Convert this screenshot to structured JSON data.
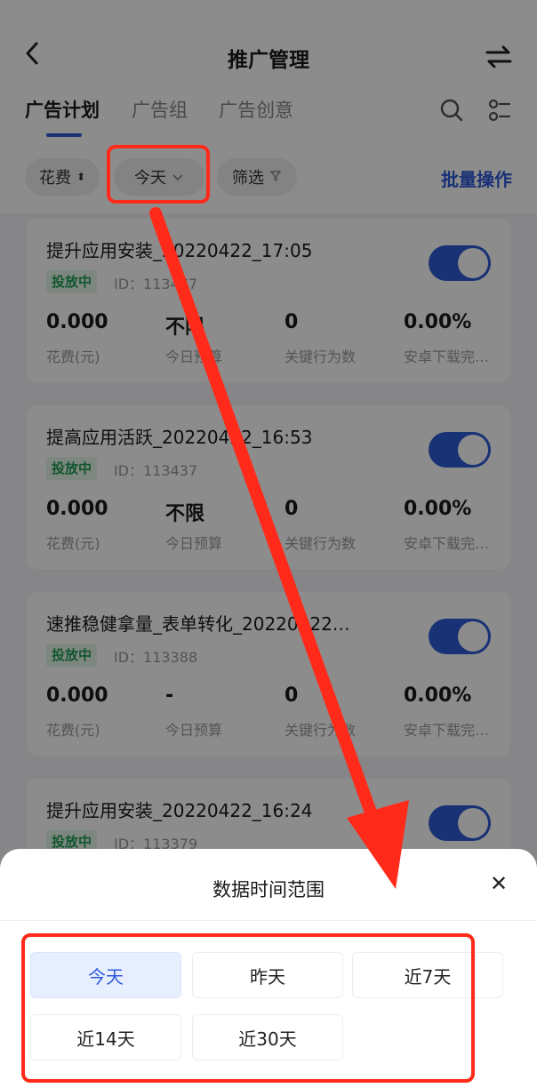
{
  "header": {
    "title": "推广管理"
  },
  "tabs": [
    {
      "label": "广告计划"
    },
    {
      "label": "广告组"
    },
    {
      "label": "广告创意"
    }
  ],
  "filters": {
    "sort_label": "花费",
    "date_label": "今天",
    "filter_label": "筛选",
    "batch_label": "批量操作"
  },
  "campaigns": [
    {
      "name": "提升应用安装_20220422_17:05",
      "status": "投放中",
      "id": "ID：113477",
      "spend": "0.000",
      "spend_label": "花费(元)",
      "budget": "不限",
      "budget_label": "今日预算",
      "actions": "0",
      "actions_label": "关键行为数",
      "rate": "0.00%",
      "rate_label": "安卓下载完…"
    },
    {
      "name": "提高应用活跃_20220422_16:53",
      "status": "投放中",
      "id": "ID：113437",
      "spend": "0.000",
      "spend_label": "花费(元)",
      "budget": "不限",
      "budget_label": "今日预算",
      "actions": "0",
      "actions_label": "关键行为数",
      "rate": "0.00%",
      "rate_label": "安卓下载完…"
    },
    {
      "name": "速推稳健拿量_表单转化_20220422…",
      "status": "投放中",
      "id": "ID：113388",
      "spend": "0.000",
      "spend_label": "花费(元)",
      "budget": "-",
      "budget_label": "今日预算",
      "actions": "0",
      "actions_label": "关键行为数",
      "rate": "0.00%",
      "rate_label": "安卓下载完…"
    },
    {
      "name": "提升应用安装_20220422_16:24",
      "status": "投放中",
      "id": "ID：113379"
    }
  ],
  "sheet": {
    "title": "数据时间范围",
    "options": [
      {
        "label": "今天"
      },
      {
        "label": "昨天"
      },
      {
        "label": "近7天"
      },
      {
        "label": "近14天"
      },
      {
        "label": "近30天"
      }
    ]
  },
  "colors": {
    "accent": "#2f59d6",
    "annotation": "#ff2a1a",
    "status_green": "#1f9d55"
  }
}
